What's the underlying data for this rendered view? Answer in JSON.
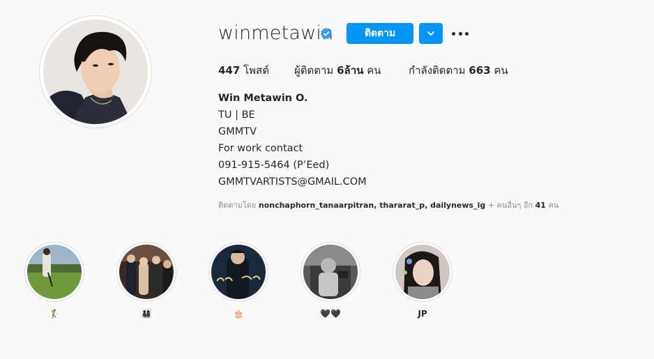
{
  "profile": {
    "username": "winmetawin",
    "verified": true,
    "follow_label": "ติดตาม",
    "stats": {
      "posts_value": "447",
      "posts_label": "โพสต์",
      "followers_label": "ผู้ติดตาม",
      "followers_value": "6ล้าน",
      "followers_unit": "คน",
      "following_label": "กำลังติดตาม",
      "following_value": "663",
      "following_unit": "คน"
    },
    "bio": {
      "name": "Win Metawin O.",
      "lines": [
        "TU | BE",
        "GMMTV",
        "For work contact",
        "091-915-5464 (P’Eed)",
        "GMMTVARTISTS@GMAIL.COM"
      ]
    },
    "followed_by": {
      "prefix": "ติดตามโดย",
      "users": "nonchaphorn_tanaarpitran, thararat_p, dailynews_ig",
      "more_prefix": "+ คนอื่นๆ อีก",
      "more_count": "41",
      "more_suffix": "คน"
    }
  },
  "highlights": [
    {
      "label": "🏌"
    },
    {
      "label": "👨‍👩‍👧‍👦"
    },
    {
      "label": "🎂"
    },
    {
      "label": "🖤🖤"
    },
    {
      "label": "JP"
    }
  ],
  "colors": {
    "accent": "#0095f6",
    "verified": "#3897f0",
    "background": "#fafafa",
    "text": "#262626",
    "muted": "#8e8e8e"
  },
  "icons": {
    "verified": "verified-badge-icon",
    "dropdown": "chevron-down-icon",
    "more": "more-options-icon"
  }
}
